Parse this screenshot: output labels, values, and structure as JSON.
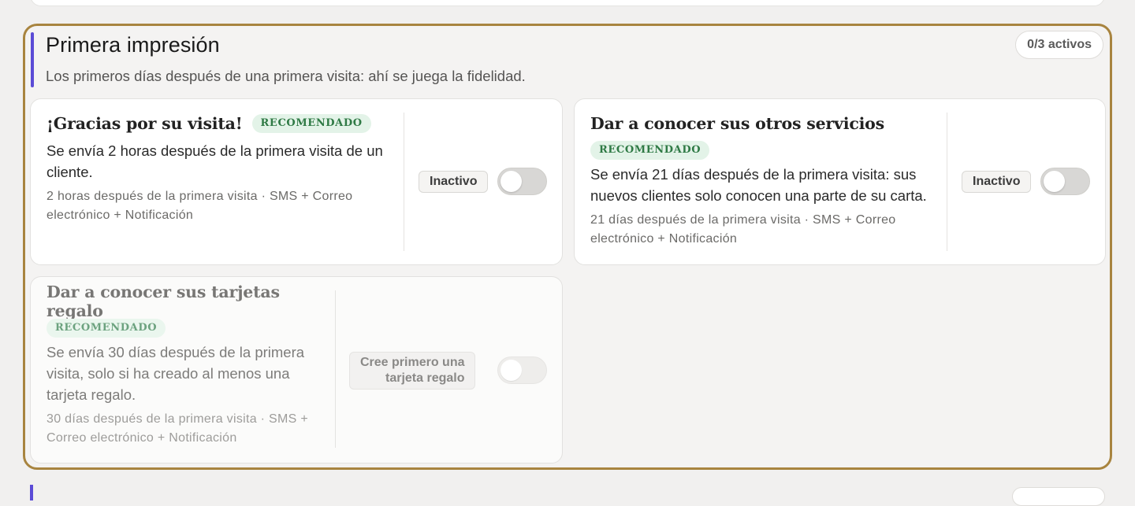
{
  "section": {
    "title": "Primera impresión",
    "subtitle": "Los primeros días después de una primera visita: ahí se juega la fidelidad.",
    "active_count": "0/3 activos",
    "colors": {
      "accent": "#5b4bd6",
      "highlight_border": "#a8843f",
      "badge_bg": "#e3f3e8",
      "badge_text": "#2f7a45"
    }
  },
  "cards": [
    {
      "title": "¡Gracias por su visita!",
      "badge": "RECOMENDADO",
      "description_lines": [
        "Se envía 2 horas después de la primera visita de un",
        "cliente."
      ],
      "meta_lines": [
        "2 horas después de la primera visita · SMS + Correo",
        "electrónico + Notificación"
      ],
      "status": "Inactivo",
      "toggle_on": false,
      "toggle_icon": "toggle-switch-icon"
    },
    {
      "title": "Dar a conocer sus otros servicios",
      "badge": "RECOMENDADO",
      "description_lines": [
        "Se envía 21 días después de la primera visita: sus",
        "nuevos clientes solo conocen una parte de su carta."
      ],
      "meta_lines": [
        "21 días después de la primera visita · SMS + Correo",
        "electrónico + Notificación"
      ],
      "status": "Inactivo",
      "toggle_on": false,
      "toggle_icon": "toggle-switch-icon"
    },
    {
      "title": "Dar a conocer sus tarjetas regalo",
      "badge": "RECOMENDADO",
      "description_lines": [
        "Se envía 30 días después de la primera",
        "visita, solo si ha creado al menos una",
        "tarjeta regalo."
      ],
      "meta_lines": [
        "30 días después de la primera visita · SMS +",
        "Correo electrónico + Notificación"
      ],
      "status_lines": [
        "Cree primero una",
        "tarjeta regalo"
      ],
      "toggle_on": false,
      "disabled": true,
      "toggle_icon": "toggle-switch-icon"
    }
  ]
}
